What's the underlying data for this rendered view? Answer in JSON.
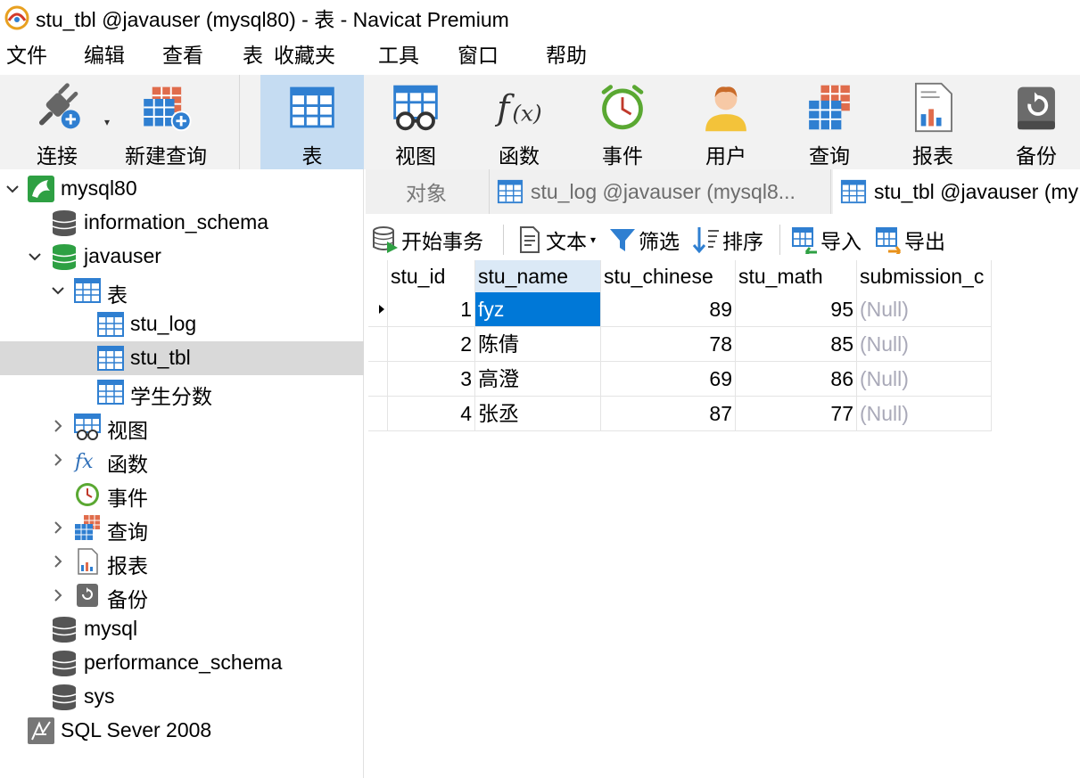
{
  "window": {
    "title": "stu_tbl @javauser (mysql80) - 表 - Navicat Premium"
  },
  "menu": [
    "文件",
    "编辑",
    "查看",
    "表",
    "收藏夹",
    "工具",
    "窗口",
    "帮助"
  ],
  "toolbar": {
    "connect": "连接",
    "new_query": "新建查询",
    "table": "表",
    "view": "视图",
    "function": "函数",
    "event": "事件",
    "user": "用户",
    "query": "查询",
    "report": "报表",
    "backup": "备份"
  },
  "tree": {
    "mysql80": "mysql80",
    "information_schema": "information_schema",
    "javauser": "javauser",
    "tables_group": "表",
    "stu_log": "stu_log",
    "stu_tbl": "stu_tbl",
    "score_table": "学生分数",
    "views": "视图",
    "functions": "函数",
    "events": "事件",
    "queries": "查询",
    "reports": "报表",
    "backups": "备份",
    "mysql": "mysql",
    "performance_schema": "performance_schema",
    "sys": "sys",
    "sqlserver": "SQL Sever 2008"
  },
  "tabs": {
    "objects": "对象",
    "stu_log": "stu_log @javauser (mysql8...",
    "stu_tbl": "stu_tbl @javauser (my"
  },
  "subtoolbar": {
    "begin_transaction": "开始事务",
    "text": "文本",
    "filter": "筛选",
    "sort": "排序",
    "import": "导入",
    "export": "导出"
  },
  "grid": {
    "columns": [
      "stu_id",
      "stu_name",
      "stu_chinese",
      "stu_math",
      "submission_c"
    ],
    "rows": [
      [
        "1",
        "fyz",
        "89",
        "95",
        "(Null)"
      ],
      [
        "2",
        "陈倩",
        "78",
        "85",
        "(Null)"
      ],
      [
        "3",
        "高澄",
        "69",
        "86",
        "(Null)"
      ],
      [
        "4",
        "张丞",
        "87",
        "77",
        "(Null)"
      ]
    ]
  },
  "colors": {
    "selection": "#0078d7",
    "tree_selected": "#d9d9d9",
    "toolbar_active": "#c5dcf2",
    "null_text": "#a9a9b8",
    "db_green": "#2ea043",
    "table_blue": "#2f7fd1"
  }
}
